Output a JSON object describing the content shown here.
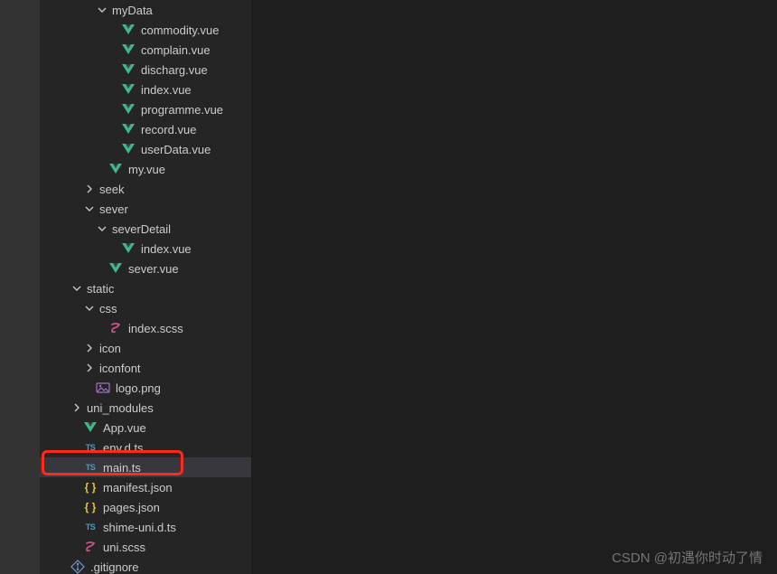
{
  "tree": [
    {
      "indent": 4,
      "chev": "down",
      "icon": "folder",
      "label": "myData"
    },
    {
      "indent": 5,
      "chev": "",
      "icon": "vue",
      "label": "commodity.vue"
    },
    {
      "indent": 5,
      "chev": "",
      "icon": "vue",
      "label": "complain.vue"
    },
    {
      "indent": 5,
      "chev": "",
      "icon": "vue",
      "label": "discharg.vue"
    },
    {
      "indent": 5,
      "chev": "",
      "icon": "vue",
      "label": "index.vue"
    },
    {
      "indent": 5,
      "chev": "",
      "icon": "vue",
      "label": "programme.vue"
    },
    {
      "indent": 5,
      "chev": "",
      "icon": "vue",
      "label": "record.vue"
    },
    {
      "indent": 5,
      "chev": "",
      "icon": "vue",
      "label": "userData.vue"
    },
    {
      "indent": 4,
      "chev": "",
      "icon": "vue",
      "label": "my.vue"
    },
    {
      "indent": 3,
      "chev": "right",
      "icon": "folder",
      "label": "seek"
    },
    {
      "indent": 3,
      "chev": "down",
      "icon": "folder",
      "label": "sever"
    },
    {
      "indent": 4,
      "chev": "down",
      "icon": "folder",
      "label": "severDetail"
    },
    {
      "indent": 5,
      "chev": "",
      "icon": "vue",
      "label": "index.vue"
    },
    {
      "indent": 4,
      "chev": "",
      "icon": "vue",
      "label": "sever.vue"
    },
    {
      "indent": 2,
      "chev": "down",
      "icon": "folder",
      "label": "static"
    },
    {
      "indent": 3,
      "chev": "down",
      "icon": "folder",
      "label": "css"
    },
    {
      "indent": 4,
      "chev": "",
      "icon": "scss",
      "label": "index.scss"
    },
    {
      "indent": 3,
      "chev": "right",
      "icon": "folder",
      "label": "icon"
    },
    {
      "indent": 3,
      "chev": "right",
      "icon": "folder",
      "label": "iconfont"
    },
    {
      "indent": 3,
      "chev": "",
      "icon": "image",
      "label": "logo.png"
    },
    {
      "indent": 2,
      "chev": "right",
      "icon": "folder",
      "label": "uni_modules"
    },
    {
      "indent": 2,
      "chev": "",
      "icon": "vue",
      "label": "App.vue"
    },
    {
      "indent": 2,
      "chev": "",
      "icon": "ts",
      "label": "env.d.ts"
    },
    {
      "indent": 2,
      "chev": "",
      "icon": "ts",
      "label": "main.ts",
      "selected": true
    },
    {
      "indent": 2,
      "chev": "",
      "icon": "json",
      "label": "manifest.json"
    },
    {
      "indent": 2,
      "chev": "",
      "icon": "json",
      "label": "pages.json"
    },
    {
      "indent": 2,
      "chev": "",
      "icon": "ts",
      "label": "shime-uni.d.ts"
    },
    {
      "indent": 2,
      "chev": "",
      "icon": "scss",
      "label": "uni.scss"
    },
    {
      "indent": 1,
      "chev": "",
      "icon": "git",
      "label": ".gitignore"
    }
  ],
  "watermark": "CSDN @初遇你时动了情",
  "colors": {
    "bg": "#1e1e1e",
    "sidebar": "#333333",
    "explorer": "#252526",
    "selected": "#37373d",
    "text": "#cccccc",
    "highlight": "#ff2a1a",
    "vue": "#41b883",
    "ts": "#519aba",
    "json": "#e8c23f",
    "scss": "#c6538c",
    "image": "#a074c4",
    "git": "#6c9bd1"
  }
}
